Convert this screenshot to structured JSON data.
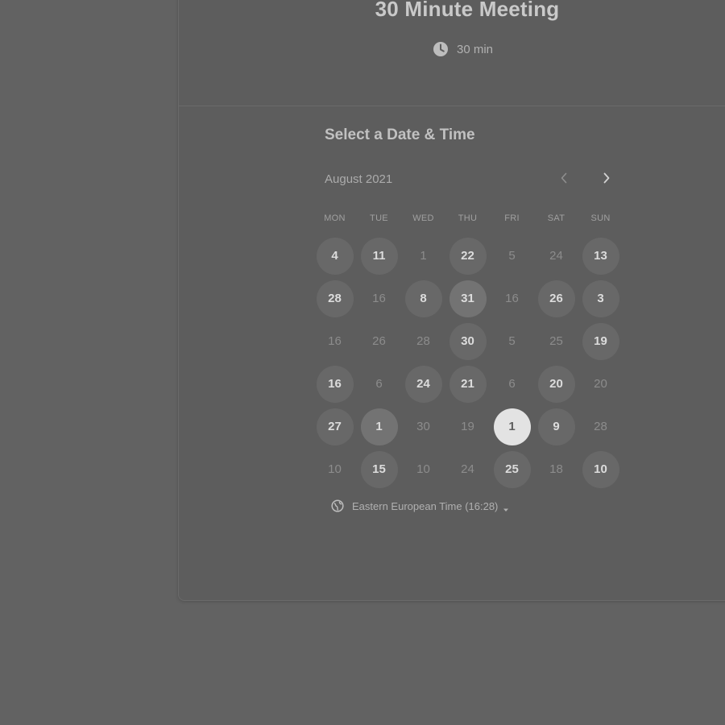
{
  "event": {
    "title": "30 Minute Meeting",
    "duration": "30 min",
    "duration_icon": "clock-icon"
  },
  "scheduler": {
    "section_title": "Select a Date & Time",
    "month_label": "August 2021",
    "prev_icon": "chevron-left-icon",
    "next_icon": "chevron-right-icon",
    "weekdays": [
      "MON",
      "TUE",
      "WED",
      "THU",
      "FRI",
      "SAT",
      "SUN"
    ],
    "weeks": [
      [
        {
          "label": "4",
          "state": "enabled"
        },
        {
          "label": "11",
          "state": "enabled"
        },
        {
          "label": "1",
          "state": "disabled"
        },
        {
          "label": "22",
          "state": "enabled"
        },
        {
          "label": "5",
          "state": "disabled"
        },
        {
          "label": "24",
          "state": "disabled"
        },
        {
          "label": "13",
          "state": "enabled"
        }
      ],
      [
        {
          "label": "28",
          "state": "enabled"
        },
        {
          "label": "16",
          "state": "disabled"
        },
        {
          "label": "8",
          "state": "enabled"
        },
        {
          "label": "31",
          "state": "highlight"
        },
        {
          "label": "16",
          "state": "disabled"
        },
        {
          "label": "26",
          "state": "enabled"
        },
        {
          "label": "3",
          "state": "enabled"
        }
      ],
      [
        {
          "label": "16",
          "state": "disabled"
        },
        {
          "label": "26",
          "state": "disabled"
        },
        {
          "label": "28",
          "state": "disabled"
        },
        {
          "label": "30",
          "state": "enabled"
        },
        {
          "label": "5",
          "state": "disabled"
        },
        {
          "label": "25",
          "state": "disabled"
        },
        {
          "label": "19",
          "state": "enabled"
        }
      ],
      [
        {
          "label": "16",
          "state": "enabled"
        },
        {
          "label": "6",
          "state": "disabled"
        },
        {
          "label": "24",
          "state": "enabled"
        },
        {
          "label": "21",
          "state": "enabled"
        },
        {
          "label": "6",
          "state": "disabled"
        },
        {
          "label": "20",
          "state": "enabled"
        },
        {
          "label": "20",
          "state": "disabled"
        }
      ],
      [
        {
          "label": "27",
          "state": "enabled"
        },
        {
          "label": "1",
          "state": "highlight"
        },
        {
          "label": "30",
          "state": "disabled"
        },
        {
          "label": "19",
          "state": "disabled"
        },
        {
          "label": "1",
          "state": "selected"
        },
        {
          "label": "9",
          "state": "enabled"
        },
        {
          "label": "28",
          "state": "disabled"
        }
      ],
      [
        {
          "label": "10",
          "state": "disabled"
        },
        {
          "label": "15",
          "state": "enabled"
        },
        {
          "label": "10",
          "state": "disabled"
        },
        {
          "label": "24",
          "state": "disabled"
        },
        {
          "label": "25",
          "state": "enabled"
        },
        {
          "label": "18",
          "state": "disabled"
        },
        {
          "label": "10",
          "state": "enabled"
        }
      ]
    ],
    "timezone_label": "Eastern European Time (16:28)",
    "timezone_icon": "globe-icon",
    "timezone_caret_icon": "caret-down-icon"
  },
  "colors": {
    "background": "#626262",
    "card": "#5d5d5d",
    "available_day": "#686868",
    "selected_day": "#e3e3e3"
  }
}
